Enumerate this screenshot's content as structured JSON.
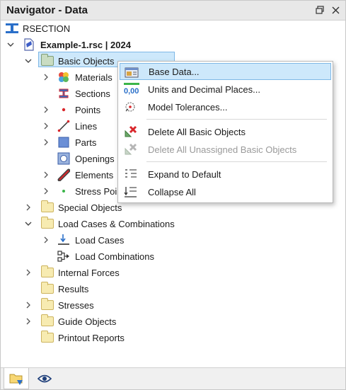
{
  "window": {
    "title": "Navigator - Data"
  },
  "tree": {
    "root": "RSECTION",
    "file": "Example-1.rsc | 2024",
    "basic_objects": {
      "label": "Basic Objects",
      "children": [
        "Materials",
        "Sections",
        "Points",
        "Lines",
        "Parts",
        "Openings",
        "Elements",
        "Stress Points"
      ]
    },
    "special_objects": "Special Objects",
    "load_cases_combinations": {
      "label": "Load Cases & Combinations",
      "children": [
        "Load Cases",
        "Load Combinations"
      ]
    },
    "internal_forces": "Internal Forces",
    "results": "Results",
    "stresses": "Stresses",
    "guide_objects": "Guide Objects",
    "printout_reports": "Printout Reports"
  },
  "context_menu": {
    "items": [
      {
        "label": "Base Data...",
        "icon": "base-data-icon",
        "state": "hover"
      },
      {
        "label": "Units and Decimal Places...",
        "icon": "units-icon",
        "icon_text": "0,00",
        "state": "normal"
      },
      {
        "label": "Model Tolerances...",
        "icon": "tolerances-icon",
        "state": "normal"
      },
      {
        "label": "Delete All Basic Objects",
        "icon": "delete-all-icon",
        "state": "normal"
      },
      {
        "label": "Delete All Unassigned Basic Objects",
        "icon": "delete-unassigned-icon",
        "state": "disabled"
      },
      {
        "label": "Expand to Default",
        "icon": "expand-icon",
        "state": "normal"
      },
      {
        "label": "Collapse All",
        "icon": "collapse-icon",
        "state": "normal"
      }
    ]
  },
  "colors": {
    "selection_bg": "#cde8fb",
    "selection_border": "#7fb8e6",
    "folder_fill": "#f7ebb1",
    "accent_blue": "#2a6fc9",
    "delete_red": "#d9262b"
  }
}
